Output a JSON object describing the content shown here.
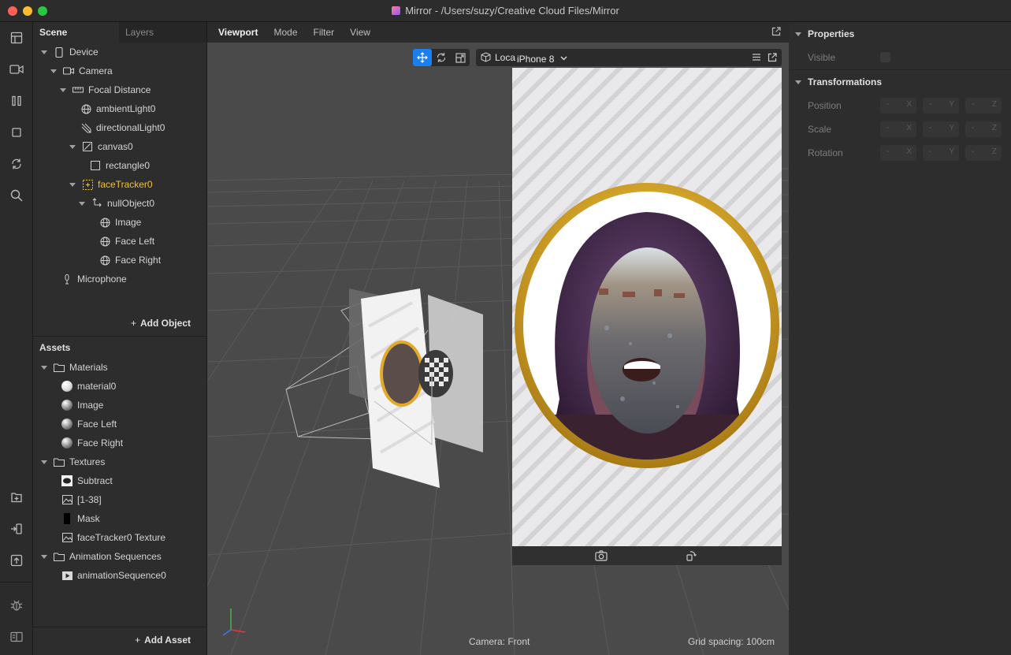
{
  "window": {
    "title": "Mirror - /Users/suzy/Creative Cloud Files/Mirror"
  },
  "scene_panel": {
    "tabs": [
      "Scene",
      "Layers"
    ],
    "tree": [
      {
        "label": "Device",
        "icon": "phone-icon"
      },
      {
        "label": "Camera",
        "icon": "camera-icon"
      },
      {
        "label": "Focal Distance",
        "icon": "ruler-icon"
      },
      {
        "label": "ambientLight0",
        "icon": "globe-icon"
      },
      {
        "label": "directionalLight0",
        "icon": "directional-light-icon"
      },
      {
        "label": "canvas0",
        "icon": "canvas-icon"
      },
      {
        "label": "rectangle0",
        "icon": "rectangle-icon"
      },
      {
        "label": "faceTracker0",
        "icon": "face-tracker-icon"
      },
      {
        "label": "nullObject0",
        "icon": "null-object-icon"
      },
      {
        "label": "Image",
        "icon": "globe-icon"
      },
      {
        "label": "Face Left",
        "icon": "globe-icon"
      },
      {
        "label": "Face Right",
        "icon": "globe-icon"
      },
      {
        "label": "Microphone",
        "icon": "microphone-icon"
      }
    ],
    "add_object": "Add Object"
  },
  "assets_panel": {
    "title": "Assets",
    "tree": [
      {
        "label": "Materials",
        "icon": "folder-icon"
      },
      {
        "label": "material0",
        "icon": "material-icon"
      },
      {
        "label": "Image",
        "icon": "material-icon"
      },
      {
        "label": "Face Left",
        "icon": "material-icon"
      },
      {
        "label": "Face Right",
        "icon": "material-icon"
      },
      {
        "label": "Textures",
        "icon": "folder-icon"
      },
      {
        "label": "Subtract",
        "icon": "texture-icon"
      },
      {
        "label": "[1-38]",
        "icon": "image-icon"
      },
      {
        "label": "Mask",
        "icon": "mask-icon"
      },
      {
        "label": "faceTracker0 Texture",
        "icon": "image-icon"
      },
      {
        "label": "Animation Sequences",
        "icon": "folder-icon"
      },
      {
        "label": "animationSequence0",
        "icon": "animation-icon"
      }
    ],
    "add_asset": "Add Asset"
  },
  "viewport": {
    "menu": [
      "Viewport",
      "Mode",
      "Filter",
      "View"
    ],
    "sim_label_short": "Loca",
    "device": "iPhone 8",
    "camera_status": "Camera: Front",
    "grid_spacing": "Grid spacing: 100cm"
  },
  "properties_panel": {
    "properties_title": "Properties",
    "visible_label": "Visible",
    "transformations_title": "Transformations",
    "rows": [
      {
        "label": "Position",
        "axes": [
          "X",
          "Y",
          "Z"
        ]
      },
      {
        "label": "Scale",
        "axes": [
          "X",
          "Y",
          "Z"
        ]
      },
      {
        "label": "Rotation",
        "axes": [
          "X",
          "Y",
          "Z"
        ]
      }
    ],
    "empty_value": "-"
  },
  "colors": {
    "accent": "#1a7ff0",
    "selected": "#f1c232",
    "frame_gold": "#d4a52a"
  }
}
